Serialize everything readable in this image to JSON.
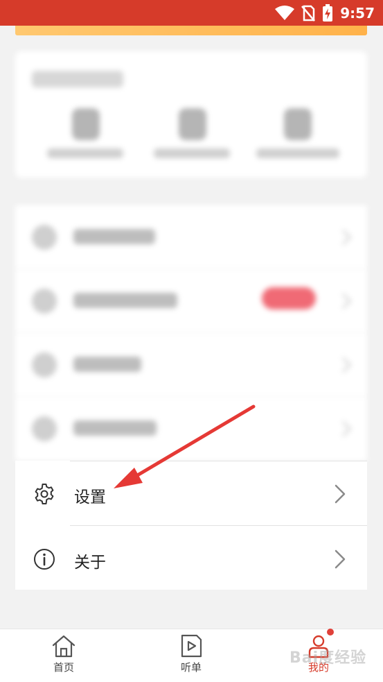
{
  "status_bar": {
    "time": "9:57",
    "icons": [
      "wifi-icon",
      "no-sim-icon",
      "battery-charging-icon"
    ],
    "background": "#d63b2a"
  },
  "menu": {
    "items": [
      {
        "label": "设置",
        "icon": "gear-icon"
      },
      {
        "label": "关于",
        "icon": "info-icon"
      }
    ]
  },
  "annotation": {
    "color": "#e53935",
    "type": "arrow"
  },
  "tab_bar": {
    "tabs": [
      {
        "label": "首页",
        "icon": "home-icon",
        "active": false
      },
      {
        "label": "听单",
        "icon": "playlist-icon",
        "active": false
      },
      {
        "label": "我的",
        "icon": "profile-icon",
        "active": true
      }
    ],
    "accent": "#d63b2a"
  },
  "watermark": {
    "text": "Bai度经验"
  }
}
